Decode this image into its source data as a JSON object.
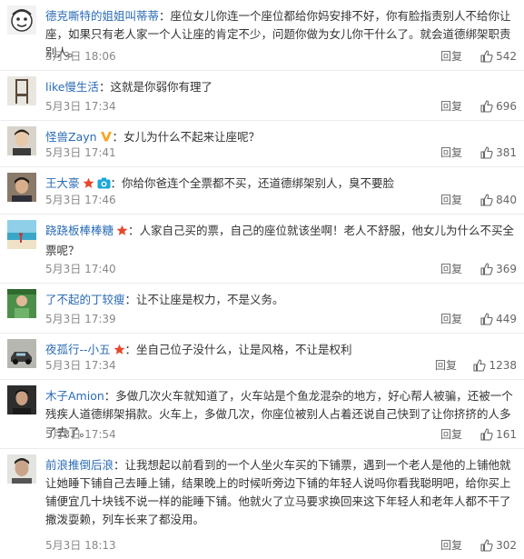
{
  "separator": "：",
  "reply_label": "回复",
  "comments": [
    {
      "user": "德克嘶特的姐姐叫蒂蒂",
      "text": "座位女儿你连一个座位都给你妈安排不好，你有脸指责别人不给你让座，如果只有老人家一个人让座的肯定不少，问题你做为女儿你干什么了。就会道德绑架职责别人。",
      "time": "5月3日 18:06",
      "likes": "542",
      "avatar": "cartoon-face"
    },
    {
      "user": "like慢生活",
      "text": "这就是你弱你有理了",
      "time": "5月3日 17:34",
      "likes": "696",
      "avatar": "chair"
    },
    {
      "user": "怪兽Zayn",
      "text": "女儿为什么不起来让座呢？",
      "time": "5月3日 17:41",
      "likes": "381",
      "avatar": "man-photo",
      "badge": "v-badge-icon"
    },
    {
      "user": "王大豪",
      "text": "你给你爸连个全票都不买，还道德绑架别人，臭不要脸",
      "time": "5月3日 17:46",
      "likes": "840",
      "avatar": "person-photo",
      "badge": "star-camera-icons"
    },
    {
      "user": "跷跷板棒棒糖",
      "text": "人家自己买的票，自己的座位就该坐啊！老人不舒服，他女儿为什么不买全票呢？",
      "time": "5月3日 17:40",
      "likes": "369",
      "avatar": "beach",
      "badge": "star-icon"
    },
    {
      "user": "了不起的丁较瘦",
      "text": "让不让座是权力，不是义务。",
      "time": "5月3日 17:39",
      "likes": "449",
      "avatar": "green-photo"
    },
    {
      "user": "夜孤行--小五",
      "text": "坐自己位子没什么，让是风格，不让是权利",
      "time": "5月3日 17:34",
      "likes": "1238",
      "avatar": "car",
      "badge": "star-icon"
    },
    {
      "user": "木子Amion",
      "text": "多做几次火车就知道了，火车站是个鱼龙混杂的地方，好心帮人被骗，还被一个残疾人道德绑架捐款。火车上，多做几次，你座位被别人占着还说自己快到了让你挤挤的人多了去了。",
      "time": "5月3日 17:54",
      "likes": "161",
      "avatar": "dark-photo"
    },
    {
      "user": "前浪推倒后浪",
      "text": "让我想起以前看到的一个人坐火车买的下铺票，遇到一个老人是他的上铺他就让她睡下铺自己去睡上铺，结果晚上的时候听旁边下铺的年轻人说吗你看我聪明吧，给你买上铺便宜几十块钱不说一样的能睡下铺。他就火了立马要求换回来这下年轻人和老年人都不干了撒泼耍赖，列车长来了都没用。",
      "time": "5月3日 18:13",
      "likes": "302",
      "avatar": "man-face"
    }
  ]
}
